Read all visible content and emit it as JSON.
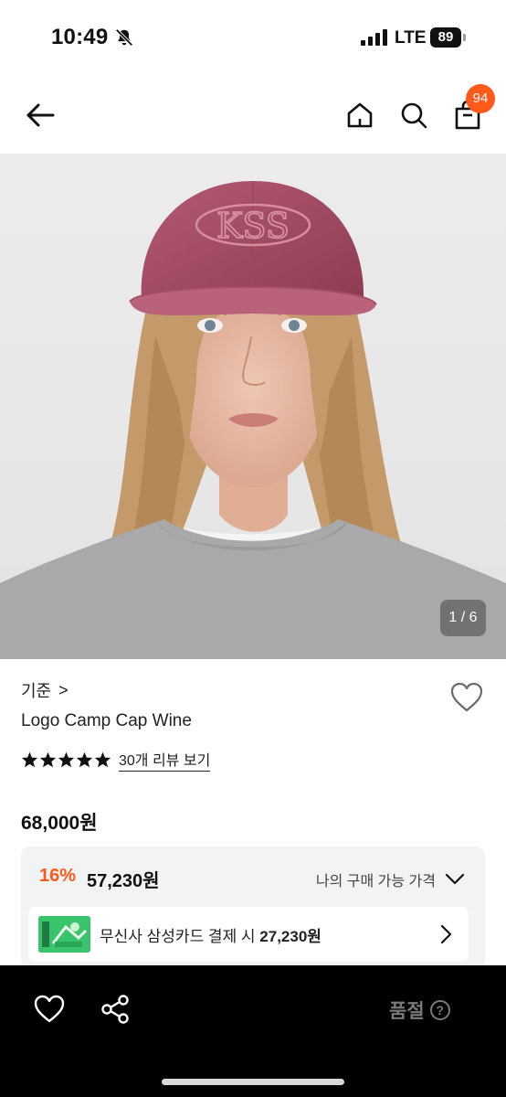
{
  "status_bar": {
    "time": "10:49",
    "network": "LTE",
    "battery": "89"
  },
  "nav": {
    "cart_count": "94"
  },
  "gallery": {
    "counter": "1 / 6"
  },
  "product": {
    "brand": "기준",
    "brand_chevron": ">",
    "name": "Logo Camp Cap Wine",
    "rating_stars": 5,
    "reviews_link": "30개 리뷰 보기",
    "price": "68,000원"
  },
  "discount": {
    "rate": "16%",
    "price": "57,230원",
    "my_price_label": "나의 구매 가능 가격"
  },
  "card_offer": {
    "text_prefix": "무신사 삼성카드 결제 시 ",
    "amount": "27,230원"
  },
  "bottom": {
    "soldout_label": "품절",
    "help_glyph": "?"
  },
  "colors": {
    "accent": "#ff5a1a",
    "cap": "#a0485e",
    "sweater": "#a9a9ab",
    "hair": "#c49a6a"
  }
}
